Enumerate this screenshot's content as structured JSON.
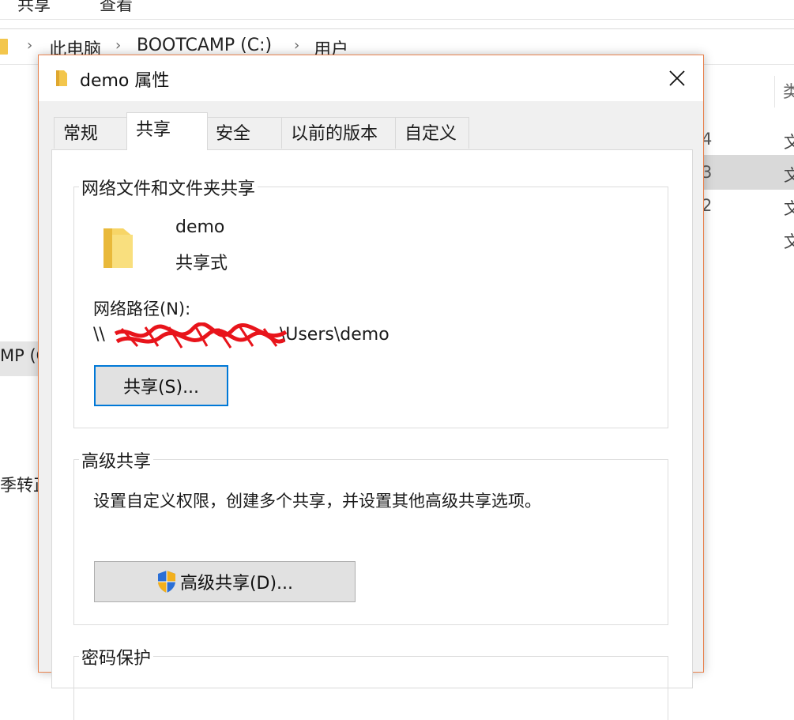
{
  "explorer": {
    "ribbon_tabs": [
      "共享",
      "查看"
    ],
    "breadcrumb": [
      "此电脑",
      "BOOTCAMP (C:)",
      "用户"
    ],
    "left_items": [
      "MP (C",
      "季转正"
    ],
    "column_header": "类",
    "column_numbers": [
      "4",
      "3",
      "2"
    ],
    "type_cells": [
      "文",
      "文",
      "文",
      "文"
    ]
  },
  "dialog": {
    "title": "demo 属性",
    "tabs": [
      "常规",
      "共享",
      "安全",
      "以前的版本",
      "自定义"
    ],
    "active_tab": "共享",
    "network_sharing": {
      "legend": "网络文件和文件夹共享",
      "folder_name": "demo",
      "share_status": "共享式",
      "path_label": "网络路径(N):",
      "path_prefix": "\\\\",
      "path_suffix": "\\Users\\demo",
      "share_button": "共享(S)..."
    },
    "advanced_sharing": {
      "legend": "高级共享",
      "description": "设置自定义权限，创建多个共享，并设置其他高级共享选项。",
      "button": "高级共享(D)..."
    },
    "password_protection": {
      "legend": "密码保护"
    }
  },
  "colors": {
    "dialog_border": "#e8824e",
    "focus_blue": "#0078d7",
    "folder_yellow": "#f3c64c",
    "redaction_red": "#e8141b"
  }
}
